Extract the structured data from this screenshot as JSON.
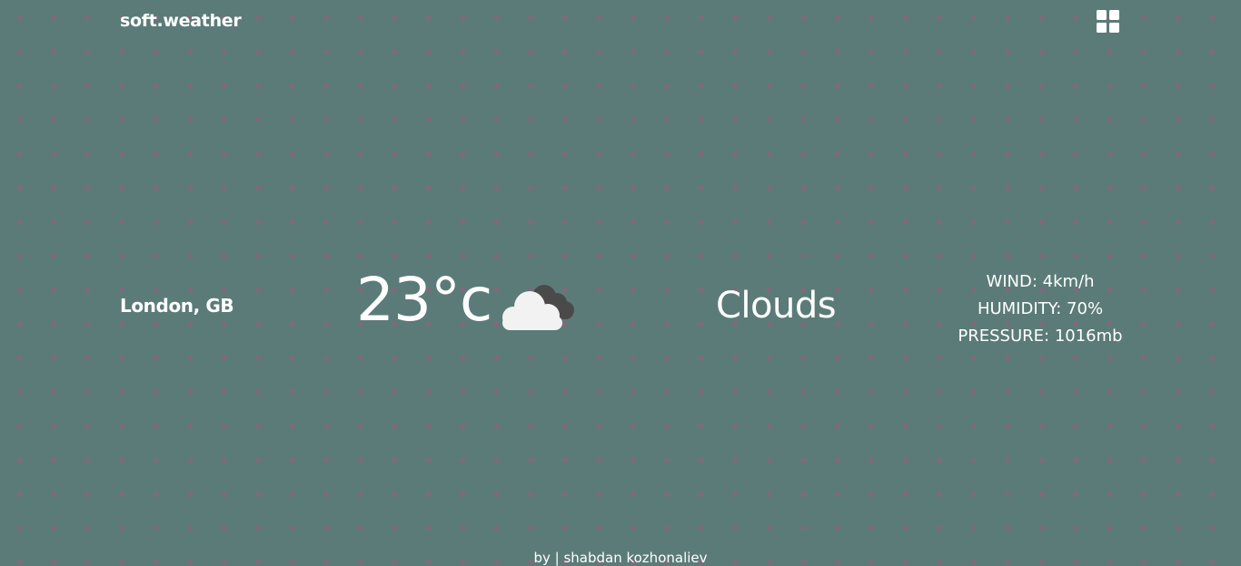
{
  "header": {
    "brand": "soft.weather",
    "menu_icon": "grid-icon"
  },
  "weather": {
    "location": "London, GB",
    "temperature": "23°c",
    "icon": "cloud-icon",
    "condition": "Clouds",
    "wind": "WIND: 4km/h",
    "humidity": "HUMIDITY: 70%",
    "pressure": "PRESSURE: 1016mb"
  },
  "footer": {
    "credit": "by | shabdan kozhonaliev"
  },
  "colors": {
    "background": "#5b7b78",
    "dots": "#7e6a7a",
    "text": "#ffffff",
    "cloud_front": "#f2f2f2",
    "cloud_back": "#4a4a4a"
  }
}
